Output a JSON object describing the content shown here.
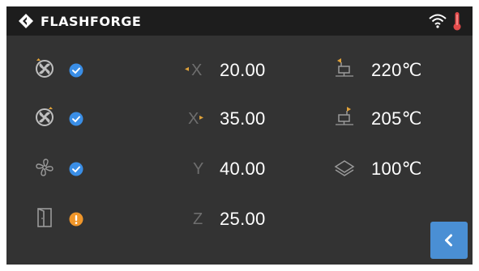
{
  "header": {
    "brand": "FLASHFORGE",
    "logo_icon": "flashforge-logo-icon",
    "wifi_icon": "wifi-icon",
    "temp_icon": "thermometer-icon"
  },
  "status_rows": [
    {
      "icon": "left-extruder-fan-icon",
      "state": "ok",
      "state_icon": "check-circle-icon"
    },
    {
      "icon": "right-extruder-fan-icon",
      "state": "ok",
      "state_icon": "check-circle-icon"
    },
    {
      "icon": "cooling-fan-icon",
      "state": "ok",
      "state_icon": "check-circle-icon"
    },
    {
      "icon": "door-icon",
      "state": "warning",
      "state_icon": "exclamation-circle-icon"
    }
  ],
  "axes": [
    {
      "label": "X",
      "direction_marker": "left",
      "value": "20.00"
    },
    {
      "label": "X",
      "direction_marker": "right",
      "value": "35.00"
    },
    {
      "label": "Y",
      "value": "40.00"
    },
    {
      "label": "Z",
      "value": "25.00"
    }
  ],
  "temperatures": [
    {
      "icon": "left-nozzle-icon",
      "value": "220℃"
    },
    {
      "icon": "right-nozzle-icon",
      "value": "205℃"
    },
    {
      "icon": "platform-layers-icon",
      "value": "100℃"
    }
  ],
  "back_button": {
    "icon": "chevron-left-icon"
  },
  "colors": {
    "background": "#333333",
    "topbar": "#1d1d1d",
    "ok": "#3a8ee6",
    "warning": "#f0962a",
    "accent": "#4a8fd4",
    "thermometer": "#e34a4a"
  }
}
